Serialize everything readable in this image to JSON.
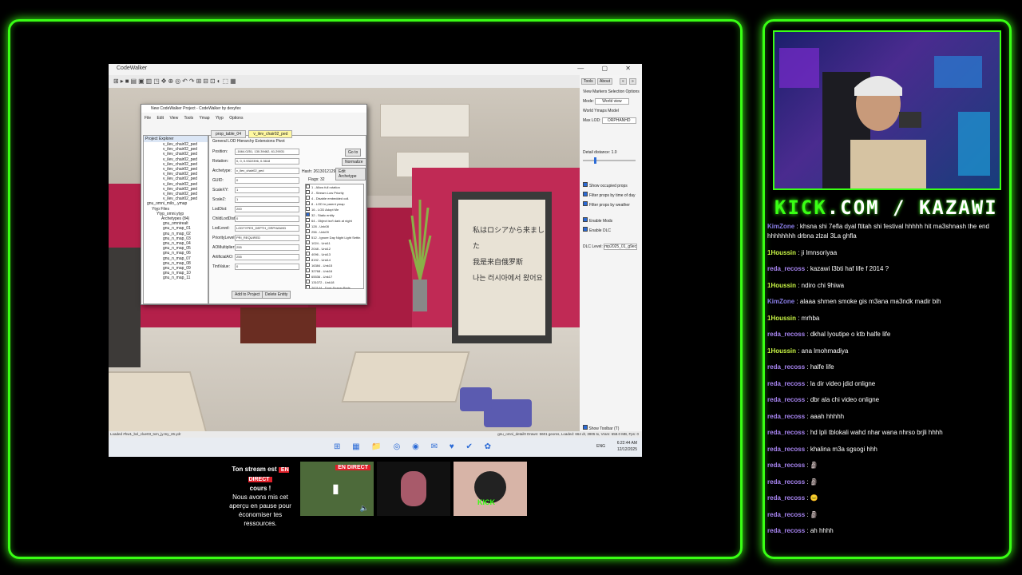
{
  "brand": {
    "kick": "KICK",
    "rest": ".COM / KAZAWI"
  },
  "capture": {
    "app_title": "CodeWalker",
    "window_controls": "—  ▢  ✕",
    "toolbar_icons": "⊞▸■▤▣▥◳✥⊕◎↶↷⊞⊟⊡◐⬚▦",
    "poster_lines": [
      "私はロシアから来ました",
      "我是来自俄罗斯",
      "나는 러시아에서 왔어요"
    ],
    "dialog": {
      "title": "New CodeWalker Project - CodeWalker by dexyfex",
      "menu": "File Edit View Tools Ymap Ytyp Options",
      "explorer_header": "Project Explorer",
      "tree": [
        "v_ilev_chair02_ped",
        "v_ilev_chair02_ped",
        "v_ilev_chair02_ped",
        "v_ilev_chair02_ped",
        "v_ilev_chair02_ped",
        "v_ilev_chair02_ped",
        "v_ilev_chair02_ped",
        "v_ilev_chair02_ped",
        "v_ilev_chair02_ped",
        "v_ilev_chair02_ped",
        "v_ilev_chair02_ped",
        "v_ilev_chair02_ped"
      ],
      "tree_sections": [
        "gnu_omni_milo_.ymap",
        "Ytyp Files",
        "Ytyp_omni.ytyp",
        "Archetypes (84)"
      ],
      "tree_sub": [
        "gnu_omnirealt",
        "gnu_n_map_01",
        "gnu_n_map_02",
        "gnu_n_map_03",
        "gnu_n_map_04",
        "gnu_n_map_05",
        "gnu_n_map_06",
        "gnu_n_map_07",
        "gnu_n_map_08",
        "gnu_n_map_09",
        "gnu_n_map_10",
        "gnu_n_map_11"
      ],
      "tabs": [
        "prop_table_04",
        "v_ilev_chair02_ped"
      ],
      "subtabs": "General   LOD Hierarchy   Extensions   Pivot",
      "fields": [
        {
          "label": "Position:",
          "value": "-1664.0251, 130.39462, 61.29031"
        },
        {
          "label": "Rotation:",
          "value": "0, 0, 0.9322396, 0.3618"
        },
        {
          "label": "Archetype:",
          "value": "v_ilev_chair02_ped"
        },
        {
          "label": "GUID:",
          "value": "0"
        },
        {
          "label": "ScaleXY:",
          "value": "1"
        },
        {
          "label": "ScaleZ:",
          "value": "1"
        },
        {
          "label": "LodDist:",
          "value": "200"
        },
        {
          "label": "ChildLodDist:",
          "value": "0"
        },
        {
          "label": "LodLevel:",
          "value": "LODTYPES_DEPTH_ORPHANHD"
        },
        {
          "label": "PriorityLevel:",
          "value": "PRI_REQUIRED"
        },
        {
          "label": "AOMultiplier:",
          "value": "255"
        },
        {
          "label": "ArtificialAO:",
          "value": "255"
        },
        {
          "label": "TintValue:",
          "value": "0"
        }
      ],
      "goto_label": "Go to",
      "normalize_label": "Normalize",
      "edit_archetype_label": "Edit Archetype",
      "hash_label": "Hash: 2613012129",
      "flags_label": "Flags:",
      "flags_value": "32",
      "flags": [
        "1 - Allow full rotation",
        "2 - Stream Low Priority",
        "4 - Disable embedded coll.",
        "8 - LOD in parent ymap",
        "16 - LOD Adopt Me",
        "32 - Static entity",
        "64 - Object isn't dark at night",
        "128 - Unk08",
        "256 - Unk09",
        "512 - Ignore Day Night Light Settin",
        "1024 - Unk11",
        "2048 - Unk12",
        "4096 - Unk13",
        "8192 - Unk14",
        "16384 - Unk15",
        "32768 - Unk16",
        "65536 - Unk17",
        "131072 - Unk18",
        "262144 - Dont Spawn Peds"
      ],
      "add_to_project": "Add to Project",
      "delete_entity": "Delete Entity"
    },
    "side_panel": {
      "top_btns": [
        "Tools",
        "About",
        "«",
        "»"
      ],
      "tabs": "View  Markers  Selection  Options",
      "mode_label": "Mode:",
      "mode_value": "World view",
      "subtabs": "World  Ymaps  Model",
      "maxlod_label": "Max LOD:",
      "maxlod_value": "ORPHANHD",
      "detail_label": "Detail distance:",
      "detail_value": "1.0",
      "checkboxes": [
        "Show occupied props",
        "Filter props by time of day",
        "Filter props by weather",
        "Enable Mods",
        "Enable DLC"
      ],
      "dlc_label": "DLC Level:",
      "dlc_value": "mp2025_01_g9ec",
      "show_toolbar": "Show Toolbar (T)"
    },
    "status_left": "Loaded #hw1_bxl_clue03_txm_jy.tny_26.ydr",
    "status_right": "gnu_omni_detail0 Drawn: 5601 geoms, Loaded: 664 dr, 3905 tx, Vram: 658.0 MB, Fps: 0",
    "taskbar_icons": "⊞ ▦ 📁 ◎ ◉ ✉ ♥ ✔ ✿",
    "lang": "ENG",
    "clock_time": "6:22:44 AM",
    "clock_date": "12/12/2025"
  },
  "offline_notice": {
    "line1": "Ton stream est",
    "badge": "EN DIRECT",
    "line2": "cours !",
    "body": "Nous avons mis cet aperçu en pause pour économiser tes ressources."
  },
  "thumb_badge": "EN DIRECT",
  "thumb3_label": "KICK",
  "chat": [
    {
      "user": "KimZone",
      "color": "#8a7ee8",
      "text": " : khsna shi 7efla dyal ftitah shi festival hhhhh hit ma3shnash the end hhhhhhhh drbna zlzal 3La ghfla"
    },
    {
      "user": "1Houssin",
      "color": "#c8f545",
      "text": " : ji lmnsoriyaa"
    },
    {
      "user": "reda_recoss",
      "color": "#a784f0",
      "text": " : kazawi l3bti haf life f 2014 ?"
    },
    {
      "user": "1Houssin",
      "color": "#c8f545",
      "text": " : ndiro chi 9hiwa"
    },
    {
      "user": "KimZone",
      "color": "#8a7ee8",
      "text": " : alaaa shmen smoke gis m3ana ma3ndk madir bih"
    },
    {
      "user": "1Houssin",
      "color": "#c8f545",
      "text": " : mrhba"
    },
    {
      "user": "reda_recoss",
      "color": "#a784f0",
      "text": " : dkhal lyoutipe o ktb halfe life"
    },
    {
      "user": "1Houssin",
      "color": "#c8f545",
      "text": " : ana lmohmadiya"
    },
    {
      "user": "reda_recoss",
      "color": "#a784f0",
      "text": " : halfe life"
    },
    {
      "user": "reda_recoss",
      "color": "#a784f0",
      "text": " : la dir video jdid onligne"
    },
    {
      "user": "reda_recoss",
      "color": "#a784f0",
      "text": " : dbr ala chi video onligne"
    },
    {
      "user": "reda_recoss",
      "color": "#a784f0",
      "text": " : aaah hhhhh"
    },
    {
      "user": "reda_recoss",
      "color": "#a784f0",
      "text": " : hd lpli tblokali wahd nhar wana nhrso brjli hhhh"
    },
    {
      "user": "reda_recoss",
      "color": "#a784f0",
      "text": " : khalina m3a sgsogi hhh"
    },
    {
      "user": "reda_recoss",
      "color": "#a784f0",
      "text": " : 🗿"
    },
    {
      "user": "reda_recoss",
      "color": "#a784f0",
      "text": " : 🗿"
    },
    {
      "user": "reda_recoss",
      "color": "#a784f0",
      "text": " : 😐"
    },
    {
      "user": "reda_recoss",
      "color": "#a784f0",
      "text": " : 🗿"
    },
    {
      "user": "reda_recoss",
      "color": "#a784f0",
      "text": " : ah hhhh"
    }
  ],
  "colors": {
    "accent": "#39ff14",
    "live_badge": "#e0202a"
  }
}
